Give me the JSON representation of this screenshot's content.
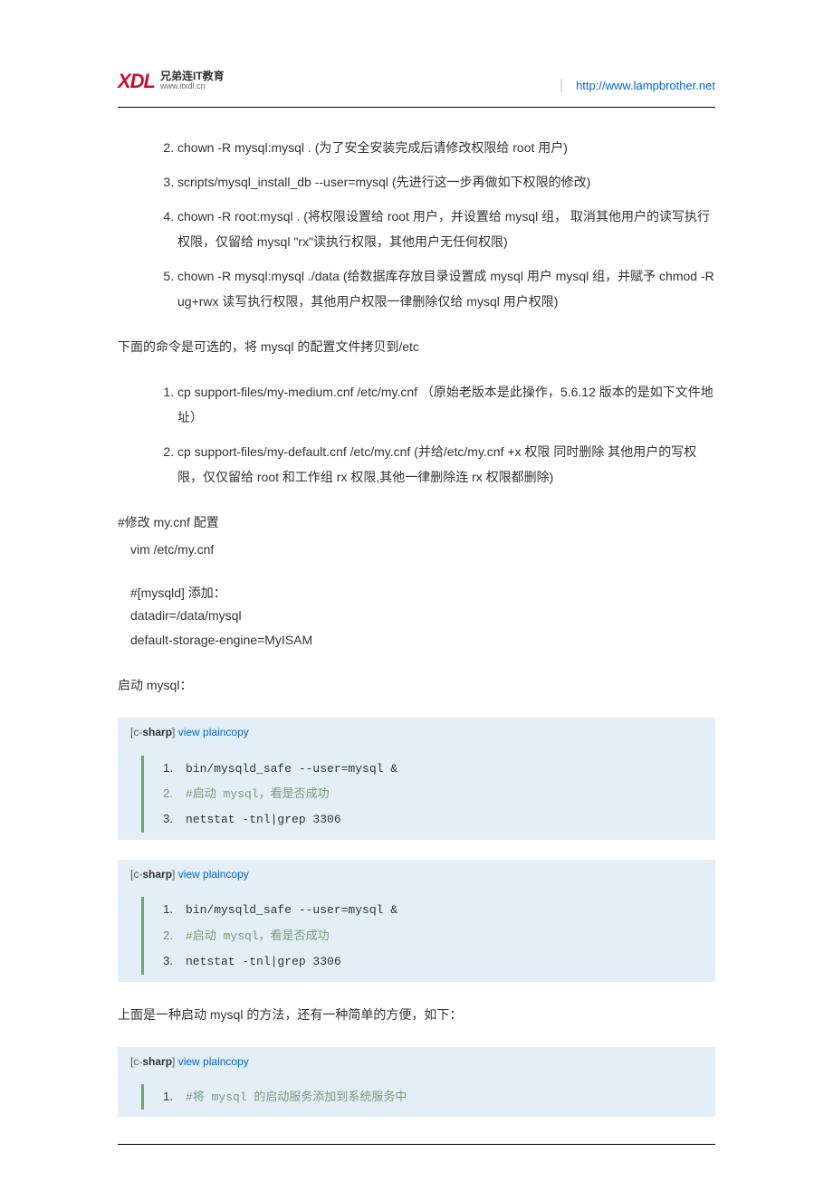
{
  "header": {
    "logo_x": "XDL",
    "logo_cn": "兄弟连IT教育",
    "logo_url": "www.itxdl.cn",
    "link": "http://www.lampbrother.net"
  },
  "list1": {
    "start": 2,
    "items": [
      "chown -R mysql:mysql . (为了安全安装完成后请修改权限给 root 用户)",
      "scripts/mysql_install_db --user=mysql (先进行这一步再做如下权限的修改)",
      "chown -R root:mysql .  (将权限设置给 root 用户，并设置给 mysql 组，  取消其他用户的读写执行权限，仅留给 mysql \"rx\"读执行权限，其他用户无任何权限)",
      "chown -R mysql:mysql ./data   (给数据库存放目录设置成 mysql 用户 mysql 组，并赋予 chmod -R ug+rwx   读写执行权限，其他用户权限一律删除仅给 mysql 用户权限)"
    ]
  },
  "para_optional": "下面的命令是可选的，将 mysql 的配置文件拷贝到/etc",
  "list2": {
    "start": 1,
    "items": [
      "cp support-files/my-medium.cnf /etc/my.cnf   （原始老版本是此操作，5.6.12 版本的是如下文件地址）",
      "cp support-files/my-default.cnf  /etc/my.cnf  (并给/etc/my.cnf +x 权限  同时删除  其他用户的写权限，仅仅留给 root  和工作组  rx 权限,其他一律删除连 rx 权限都删除)"
    ]
  },
  "cfg": {
    "comment": "#修改 my.cnf 配置",
    "l1": "vim /etc/my.cnf",
    "l2": "#[mysqld]  添加：",
    "l3": "datadir=/data/mysql",
    "l4": "default-storage-engine=MyISAM"
  },
  "start_mysql": "启动 mysql：",
  "codeheader": {
    "lang_open": "[c-",
    "lang_bold": "sharp",
    "lang_close": "]",
    "links": "view plaincopy"
  },
  "code1": {
    "l1": "bin/mysqld_safe --user=mysql &",
    "l2": "#启动 mysql，看是否成功",
    "l3": "netstat -tnl|grep 3306"
  },
  "para_simple": "上面是一种启动 mysql 的方法，还有一种简单的方便，如下：",
  "code3": {
    "l1": "#将 mysql 的启动服务添加到系统服务中"
  }
}
